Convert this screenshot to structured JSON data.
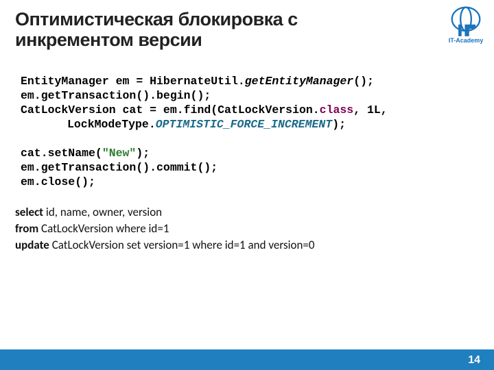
{
  "title": "Оптимистическая блокировка с инкрементом версии",
  "logo_text": "IT-Academy",
  "code": {
    "l1a": "EntityManager em = HibernateUtil.",
    "l1b": "getEntityManager",
    "l1c": "();",
    "l2": "em.getTransaction().begin();",
    "l3a": "CatLockVersion cat = em.find(CatLockVersion.",
    "l3b": "class",
    "l3c": ", 1L,",
    "l4a": "LockModeType.",
    "l4b": "OPTIMISTIC_FORCE_INCREMENT",
    "l4c": ");",
    "l5a": "cat.setName(",
    "l5b": "\"New\"",
    "l5c": ");",
    "l6": "em.getTransaction().commit();",
    "l7": "em.close();"
  },
  "sql": {
    "select_kw": "select",
    "select_cols": " id, name,  owner, version",
    "from_kw": "from",
    "from_rest": " CatLockVersion where id=1",
    "update_kw": "update",
    "update_rest": " CatLockVersion set version=1 where id=1 and version=0"
  },
  "page_number": "14"
}
